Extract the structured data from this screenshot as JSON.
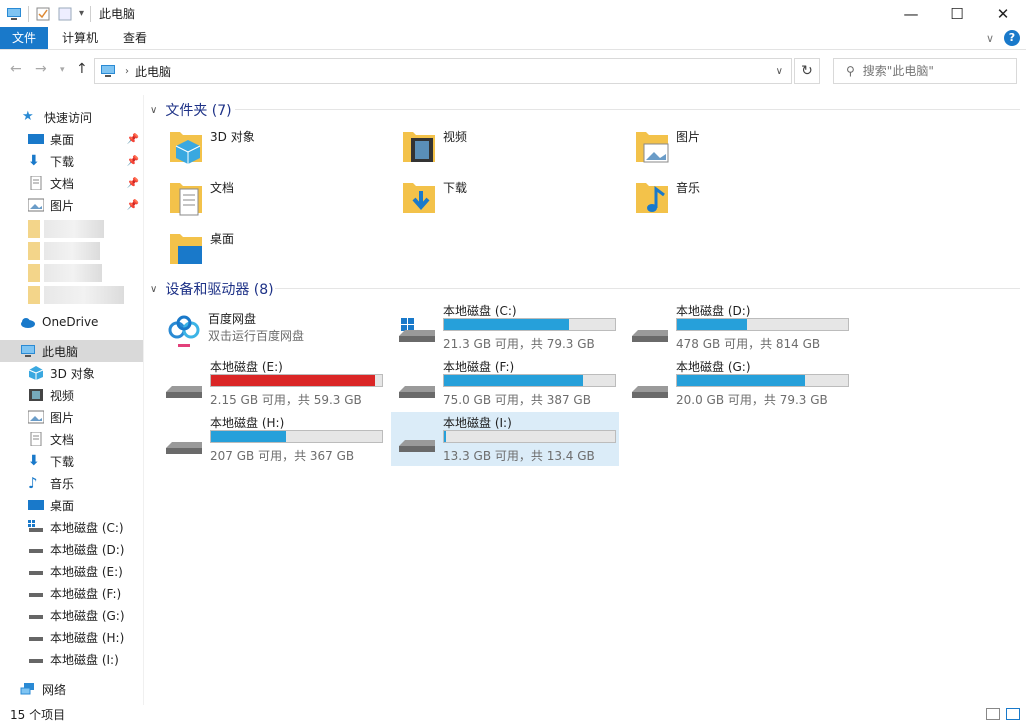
{
  "window": {
    "title": "此电脑",
    "minimize_glyph": "—",
    "maximize_glyph": "☐",
    "close_glyph": "✕"
  },
  "ribbon": {
    "tabs": [
      "文件",
      "计算机",
      "查看"
    ],
    "expand_glyph": "∨",
    "help_glyph": "?"
  },
  "address": {
    "path": "此电脑",
    "search_placeholder": "搜索\"此电脑\""
  },
  "sidebar": {
    "quick_access": "快速访问",
    "pinned": [
      "桌面",
      "下载",
      "文档",
      "图片"
    ],
    "onedrive": "OneDrive",
    "this_pc": "此电脑",
    "this_pc_items": [
      "3D 对象",
      "视频",
      "图片",
      "文档",
      "下载",
      "音乐",
      "桌面",
      "本地磁盘 (C:)",
      "本地磁盘 (D:)",
      "本地磁盘 (E:)",
      "本地磁盘 (F:)",
      "本地磁盘 (G:)",
      "本地磁盘 (H:)",
      "本地磁盘 (I:)"
    ],
    "network": "网络"
  },
  "folders_group": {
    "header": "文件夹 (7)",
    "items": [
      "3D 对象",
      "视频",
      "图片",
      "文档",
      "下载",
      "音乐",
      "桌面"
    ]
  },
  "devices_group": {
    "header": "设备和驱动器 (8)",
    "app": {
      "name": "百度网盘",
      "subtitle": "双击运行百度网盘"
    },
    "drives": [
      {
        "name": "本地磁盘 (C:)",
        "info": "21.3 GB 可用，共 79.3 GB",
        "used_fraction": 0.73
      },
      {
        "name": "本地磁盘 (D:)",
        "info": "478 GB 可用，共 814 GB",
        "used_fraction": 0.41
      },
      {
        "name": "本地磁盘 (E:)",
        "info": "2.15 GB 可用，共 59.3 GB",
        "used_fraction": 0.96
      },
      {
        "name": "本地磁盘 (F:)",
        "info": "75.0 GB 可用，共 387 GB",
        "used_fraction": 0.81
      },
      {
        "name": "本地磁盘 (G:)",
        "info": "20.0 GB 可用，共 79.3 GB",
        "used_fraction": 0.75
      },
      {
        "name": "本地磁盘 (H:)",
        "info": "207 GB 可用，共 367 GB",
        "used_fraction": 0.44
      },
      {
        "name": "本地磁盘 (I:)",
        "info": "13.3 GB 可用，共 13.4 GB",
        "used_fraction": 0.01
      }
    ]
  },
  "status": {
    "item_count": "15 个项目"
  },
  "colors": {
    "accent": "#1979ca",
    "bar_normal": "#26a0da",
    "bar_full": "#da2626",
    "group_header": "#1e3287"
  }
}
